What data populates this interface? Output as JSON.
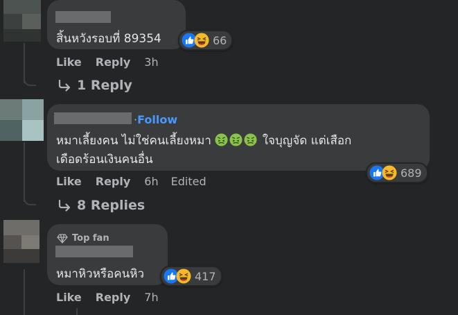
{
  "comments": [
    {
      "text": "สิ้นหวังรอบที่ 89354",
      "reaction_icons": [
        "like-icon",
        "haha-icon"
      ],
      "reaction_count": "66",
      "actions": {
        "like": "Like",
        "reply": "Reply",
        "time": "3h"
      },
      "replies_label": "1 Reply"
    },
    {
      "follow_label": "Follow",
      "text_line1": "หมาเลี้ยงคน ไม่ใช่คนเลี้ยงหมา",
      "text_line1_tail": "ใจบุญจัด แต่เสือก",
      "text_line2": "เดือดร้อนเงินคนอื่น",
      "inline_emojis": [
        "sick-face-icon",
        "sick-face-icon",
        "sick-face-icon"
      ],
      "reaction_icons": [
        "like-icon",
        "haha-icon"
      ],
      "reaction_count": "689",
      "actions": {
        "like": "Like",
        "reply": "Reply",
        "time": "6h",
        "edited": "Edited"
      },
      "replies_label": "8 Replies"
    },
    {
      "badge": "Top fan",
      "text": "หมาหิวหรือคนหิว",
      "reaction_icons": [
        "like-icon",
        "haha-icon"
      ],
      "reaction_count": "417",
      "actions": {
        "like": "Like",
        "reply": "Reply",
        "time": "7h"
      }
    }
  ],
  "colors": {
    "background": "#242526",
    "bubble": "#3a3b3c",
    "text": "#e4e6eb",
    "secondary_text": "#b0b3b8",
    "follow_link": "#4599ff",
    "like_blue": "#1877f2",
    "haha_yellow": "#f7b928"
  }
}
